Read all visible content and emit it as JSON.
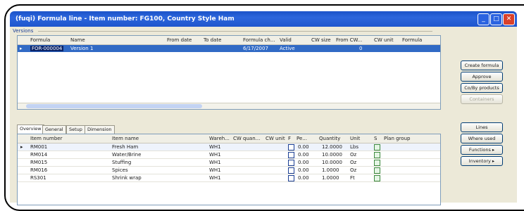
{
  "window": {
    "title": "(fuqi) Formula line - Item number: FG100, Country Style Ham",
    "controls": [
      "minimize",
      "maximize",
      "close"
    ]
  },
  "versions_group": {
    "label": "Versions"
  },
  "versions_grid": {
    "columns": [
      "Formula",
      "Name",
      "From date",
      "To date",
      "Formula ch...",
      "Valid",
      "CW size",
      "From CW...",
      "CW unit",
      "Formula"
    ],
    "row": {
      "formula": "FOR-000004",
      "name": "Version 1",
      "formula_ch": "6/17/2007",
      "valid": "Active",
      "from_cw": "0"
    }
  },
  "tabs": [
    "Overview",
    "General",
    "Setup",
    "Dimension"
  ],
  "lines_grid": {
    "columns": [
      "Item number",
      "Item name",
      "Wareh...",
      "CW quan...",
      "CW unit",
      "F",
      "Pe...",
      "Quantity",
      "Unit",
      "S",
      "Plan group"
    ],
    "rows": [
      {
        "item": "RM001",
        "name": "Fresh Ham",
        "wh": "WH1",
        "pe": "0.00",
        "qty": "12.0000",
        "unit": "Lbs"
      },
      {
        "item": "RM014",
        "name": "Water/Brine",
        "wh": "WH1",
        "pe": "0.00",
        "qty": "10.0000",
        "unit": "Oz"
      },
      {
        "item": "RM015",
        "name": "Stuffing",
        "wh": "WH1",
        "pe": "0.00",
        "qty": "10.0000",
        "unit": "Oz"
      },
      {
        "item": "RM016",
        "name": "Spices",
        "wh": "WH1",
        "pe": "0.00",
        "qty": "1.0000",
        "unit": "Oz"
      },
      {
        "item": "RS301",
        "name": "Shrink wrap",
        "wh": "WH1",
        "pe": "0.00",
        "qty": "1.0000",
        "unit": "Ft"
      }
    ]
  },
  "side_buttons": [
    "Create formula",
    "Approve",
    "Co/By products",
    "Containers",
    "Lines",
    "Where used",
    "Functions ▸",
    "Inventory ▸"
  ]
}
